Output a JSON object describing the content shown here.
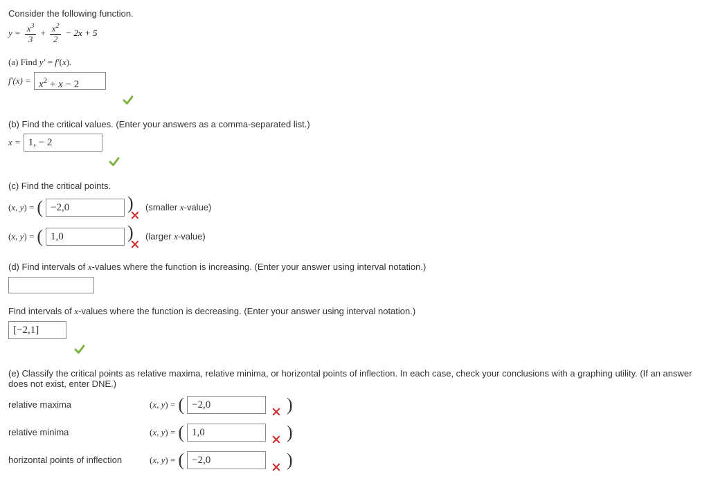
{
  "intro": "Consider the following function.",
  "function": {
    "y_eq": "y =",
    "frac1_num_var": "x",
    "frac1_num_pow": "3",
    "frac1_den": "3",
    "plus1": "+",
    "frac2_num_var": "x",
    "frac2_num_pow": "2",
    "frac2_den": "2",
    "tail": "− 2x + 5"
  },
  "a": {
    "prompt": "(a) Find y' = f'(x).",
    "lhs": "f'(x) =",
    "answer": "x² + x − 2"
  },
  "b": {
    "prompt": "(b) Find the critical values. (Enter your answers as a comma-separated list.)",
    "lhs": "x =",
    "answer": "1, − 2"
  },
  "c": {
    "prompt": "(c) Find the critical points.",
    "lhs": "(x, y) =",
    "ans1": "−2,0",
    "hint1": "(smaller x-value)",
    "ans2": "1,0",
    "hint2": "(larger x-value)"
  },
  "d": {
    "prompt": "(d) Find intervals of x-values where the function is increasing. (Enter your answer using interval notation.)",
    "answer": "",
    "prompt2": "Find intervals of x-values where the function is decreasing. (Enter your answer using interval notation.)",
    "answer2": "[−2,1]"
  },
  "e": {
    "prompt": "(e) Classify the critical points as relative maxima, relative minima, or horizontal points of inflection. In each case, check your conclusions with a graphing utility. (If an answer does not exist, enter DNE.)",
    "row1_label": "relative maxima",
    "row2_label": "relative minima",
    "row3_label": "horizontal points of inflection",
    "xy": "(x, y) =",
    "ans1": "−2,0",
    "ans2": "1,0",
    "ans3": "−2,0"
  }
}
